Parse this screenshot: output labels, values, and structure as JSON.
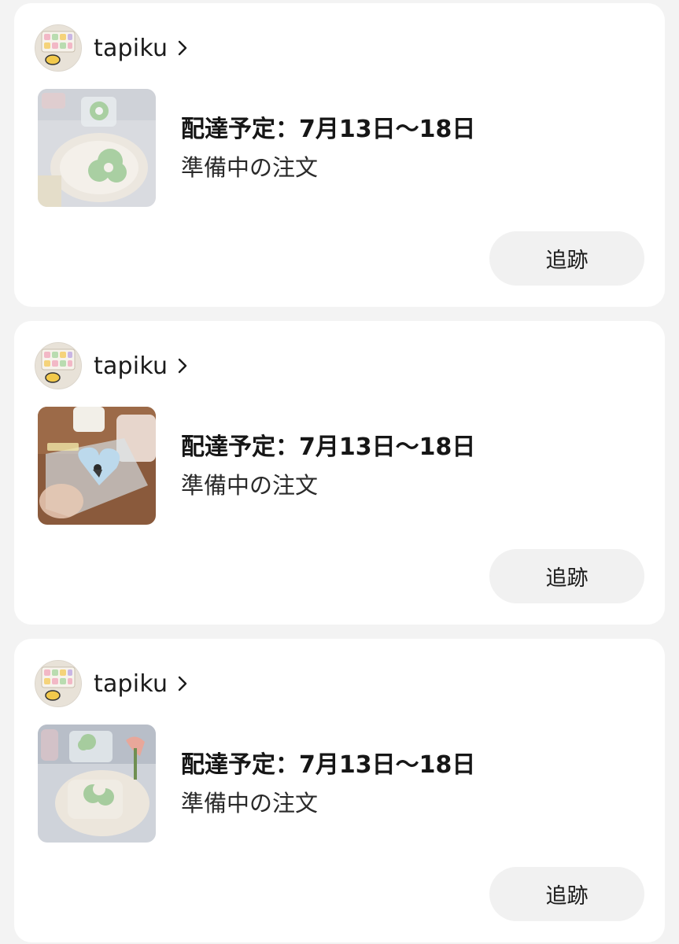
{
  "orders": [
    {
      "shop_name": "tapiku",
      "delivery": "配達予定：7月13日〜18日",
      "status": "準備中の注文",
      "track_label": "追跡"
    },
    {
      "shop_name": "tapiku",
      "delivery": "配達予定：7月13日〜18日",
      "status": "準備中の注文",
      "track_label": "追跡"
    },
    {
      "shop_name": "tapiku",
      "delivery": "配達予定：7月13日〜18日",
      "status": "準備中の注文",
      "track_label": "追跡"
    }
  ],
  "icons": {
    "chevron": "chevron-right-icon"
  },
  "colors": {
    "page_background": "#f3f3f3",
    "card_background": "#ffffff",
    "button_background": "#f1f1f1",
    "text": "#1b1b1b"
  }
}
